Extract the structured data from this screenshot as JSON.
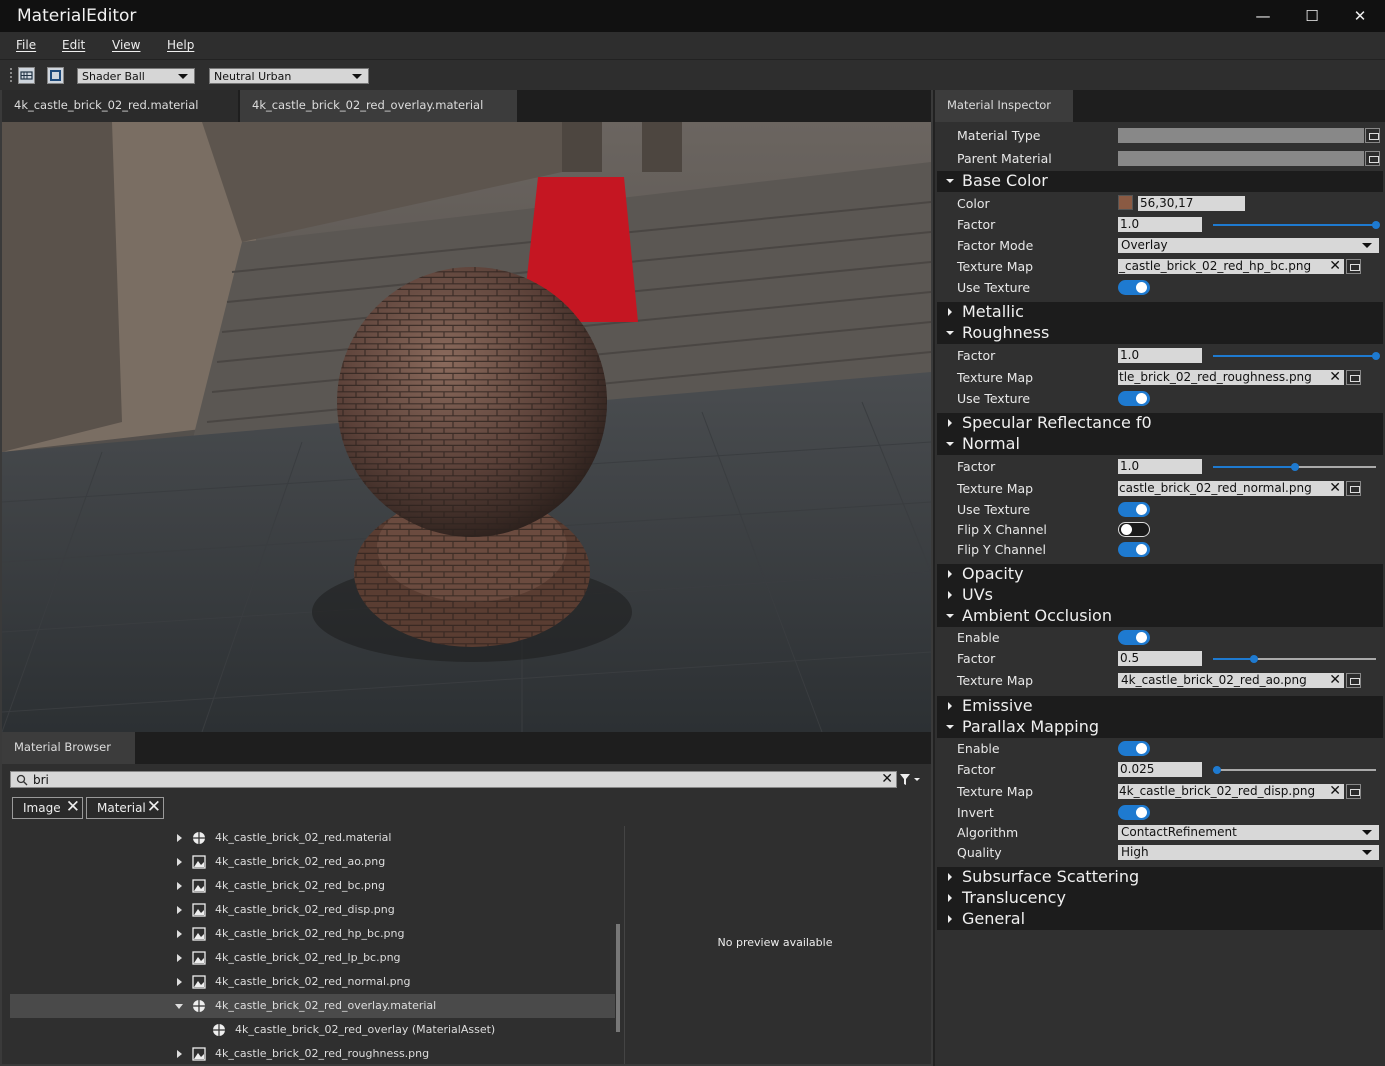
{
  "window": {
    "title": "MaterialEditor",
    "minimize": "—",
    "maximize": "☐",
    "close": "✕"
  },
  "menu": [
    "File",
    "Edit",
    "View",
    "Help"
  ],
  "toolbar": {
    "model_select": "Shader Ball",
    "lighting_select": "Neutral Urban"
  },
  "document_tabs": [
    "4k_castle_brick_02_red.material",
    "4k_castle_brick_02_red_overlay.material"
  ],
  "browser": {
    "tab": "Material Browser",
    "search_value": "bri",
    "filters": [
      "Image",
      "Material"
    ],
    "items": [
      {
        "label": "4k_castle_brick_02_red.material",
        "type": "material",
        "expanded": false
      },
      {
        "label": "4k_castle_brick_02_red_ao.png",
        "type": "image",
        "expanded": false
      },
      {
        "label": "4k_castle_brick_02_red_bc.png",
        "type": "image",
        "expanded": false
      },
      {
        "label": "4k_castle_brick_02_red_disp.png",
        "type": "image",
        "expanded": false
      },
      {
        "label": "4k_castle_brick_02_red_hp_bc.png",
        "type": "image",
        "expanded": false
      },
      {
        "label": "4k_castle_brick_02_red_lp_bc.png",
        "type": "image",
        "expanded": false
      },
      {
        "label": "4k_castle_brick_02_red_normal.png",
        "type": "image",
        "expanded": false
      },
      {
        "label": "4k_castle_brick_02_red_overlay.material",
        "type": "material",
        "expanded": true,
        "selected": true
      },
      {
        "label": "4k_castle_brick_02_red_overlay (MaterialAsset)",
        "type": "asset",
        "child": true
      },
      {
        "label": "4k_castle_brick_02_red_roughness.png",
        "type": "image",
        "expanded": false
      }
    ],
    "preview_text": "No preview available"
  },
  "inspector": {
    "tab": "Material Inspector",
    "material_type_label": "Material Type",
    "parent_material_label": "Parent Material",
    "base_color": {
      "title": "Base Color",
      "color_label": "Color",
      "color_value": "56,30,17",
      "swatch": "#8a5a43",
      "factor_label": "Factor",
      "factor_value": "1.0",
      "factor_mode_label": "Factor Mode",
      "factor_mode_value": "Overlay",
      "texture_map_label": "Texture Map",
      "texture_map_value": "_castle_brick_02_red_hp_bc.png",
      "use_texture_label": "Use Texture"
    },
    "metallic": {
      "title": "Metallic"
    },
    "roughness": {
      "title": "Roughness",
      "factor_label": "Factor",
      "factor_value": "1.0",
      "texture_map_label": "Texture Map",
      "texture_map_value": "tle_brick_02_red_roughness.png",
      "use_texture_label": "Use Texture"
    },
    "specular": {
      "title": "Specular Reflectance f0"
    },
    "normal": {
      "title": "Normal",
      "factor_label": "Factor",
      "factor_value": "1.0",
      "texture_map_label": "Texture Map",
      "texture_map_value": "castle_brick_02_red_normal.png",
      "use_texture_label": "Use Texture",
      "flip_x_label": "Flip X Channel",
      "flip_y_label": "Flip Y Channel"
    },
    "opacity": {
      "title": "Opacity"
    },
    "uvs": {
      "title": "UVs"
    },
    "ambient_occlusion": {
      "title": "Ambient Occlusion",
      "enable_label": "Enable",
      "factor_label": "Factor",
      "factor_value": "0.5",
      "texture_map_label": "Texture Map",
      "texture_map_value": "4k_castle_brick_02_red_ao.png"
    },
    "emissive": {
      "title": "Emissive"
    },
    "parallax": {
      "title": "Parallax Mapping",
      "enable_label": "Enable",
      "factor_label": "Factor",
      "factor_value": "0.025",
      "texture_map_label": "Texture Map",
      "texture_map_value": "4k_castle_brick_02_red_disp.png",
      "invert_label": "Invert",
      "algorithm_label": "Algorithm",
      "algorithm_value": "ContactRefinement",
      "quality_label": "Quality",
      "quality_value": "High"
    },
    "subsurface": {
      "title": "Subsurface Scattering"
    },
    "translucency": {
      "title": "Translucency"
    },
    "general": {
      "title": "General"
    }
  },
  "colors": {
    "accent": "#1e7ad0",
    "panel": "#303030",
    "header": "#1c1c1c"
  }
}
